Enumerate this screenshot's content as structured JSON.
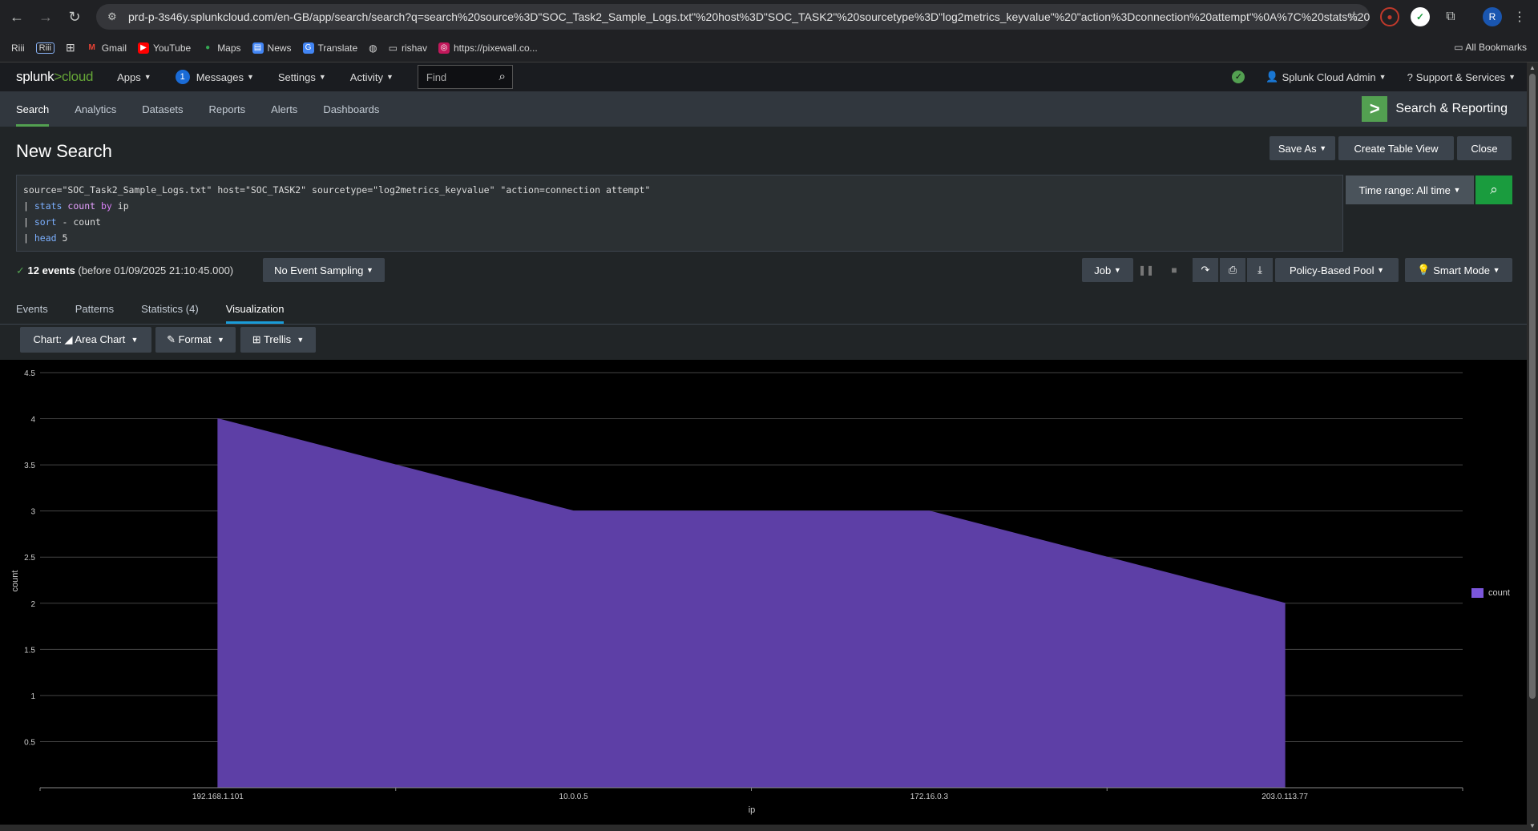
{
  "browser": {
    "url": "prd-p-3s46y.splunkcloud.com/en-GB/app/search/search?q=search%20source%3D\"SOC_Task2_Sample_Logs.txt\"%20host%3D\"SOC_TASK2\"%20sourcetype%3D\"log2metrics_keyvalue\"%20\"action%3Dconnection%20attempt\"%0A%7C%20stats%20...",
    "bookmarks": [
      "Riii",
      "Riii",
      "Gmail",
      "YouTube",
      "Maps",
      "News",
      "Translate",
      "rishav",
      "https://pixewall.co..."
    ],
    "all_bookmarks": "All Bookmarks",
    "profile_initial": "R"
  },
  "splunk": {
    "logo_left": "splunk",
    "logo_right": "cloud",
    "menus": {
      "apps": "Apps",
      "messages": "Messages",
      "messages_count": "1",
      "settings": "Settings",
      "activity": "Activity"
    },
    "find_placeholder": "Find",
    "user": "Splunk Cloud Admin",
    "support": "Support & Services"
  },
  "app_nav": {
    "tabs": [
      "Search",
      "Analytics",
      "Datasets",
      "Reports",
      "Alerts",
      "Dashboards"
    ],
    "app_title": "Search & Reporting"
  },
  "search": {
    "page_title": "New Search",
    "save_as": "Save As",
    "create_table_view": "Create Table View",
    "close": "Close",
    "query_line1": "source=\"SOC_Task2_Sample_Logs.txt\" host=\"SOC_TASK2\" sourcetype=\"log2metrics_keyvalue\" \"action=connection attempt\"",
    "query_line2_pipe": "| ",
    "query_line2_cmd": "stats",
    "query_line2_fn": "count",
    "query_line2_kw": "by",
    "query_line2_rest": " ip",
    "query_line3_cmd": "sort",
    "query_line3_rest": " - count",
    "query_line4_cmd": "head",
    "query_line4_rest": " 5",
    "time_range": "Time range: All time",
    "events_count": "12 events",
    "events_before": "(before 01/09/2025 21:10:45.000)",
    "sampling": "No Event Sampling",
    "job": "Job",
    "pool": "Policy-Based Pool",
    "mode": "Smart Mode"
  },
  "result_tabs": [
    "Events",
    "Patterns",
    "Statistics (4)",
    "Visualization"
  ],
  "viz_controls": {
    "chart": "Chart: ◢ Area Chart",
    "format": "✎ Format",
    "trellis": "⊞ Trellis"
  },
  "chart_data": {
    "type": "area",
    "categories": [
      "192.168.1.101",
      "10.0.0.5",
      "172.16.0.3",
      "203.0.113.77"
    ],
    "series": [
      {
        "name": "count",
        "values": [
          4,
          3,
          3,
          2
        ]
      }
    ],
    "xlabel": "ip",
    "ylabel": "count",
    "ylim": [
      0,
      4.5
    ],
    "yticks": [
      0.5,
      1,
      1.5,
      2,
      2.5,
      3,
      3.5,
      4,
      4.5
    ],
    "legend": "right",
    "grid": true,
    "color": "#5d3fa6"
  }
}
